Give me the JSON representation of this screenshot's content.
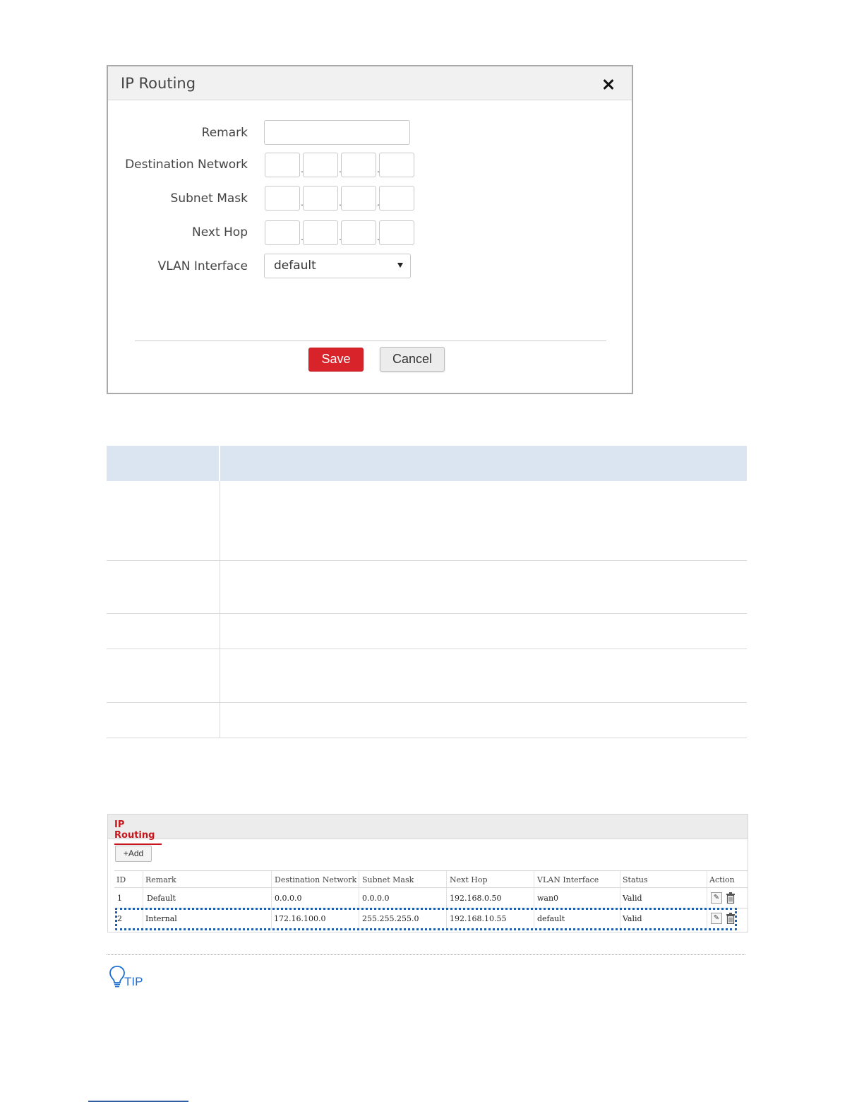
{
  "dialog": {
    "title": "IP Routing",
    "close_icon": "close-icon",
    "fields": {
      "remark_label": "Remark",
      "remark_value": "",
      "destination_label": "Destination Network",
      "subnet_label": "Subnet Mask",
      "nexthop_label": "Next Hop",
      "vlan_label": "VLAN Interface",
      "vlan_value": "default",
      "ip_separator": "."
    },
    "save_label": "Save",
    "cancel_label": "Cancel",
    "colors": {
      "save_bg": "#d9232b",
      "header_bg": "#f1f1f1"
    }
  },
  "param_table": {
    "header_color": "#dbe5f1",
    "rows": 5
  },
  "route_list": {
    "tab_label": "IP Routing",
    "add_label": "+Add",
    "columns": [
      "ID",
      "Remark",
      "Destination Network",
      "Subnet Mask",
      "Next Hop",
      "VLAN Interface",
      "Status",
      "Action"
    ],
    "rows": [
      {
        "id": "1",
        "remark": "Default",
        "destination": "0.0.0.0",
        "mask": "0.0.0.0",
        "next_hop": "192.168.0.50",
        "vlan": "wan0",
        "status": "Valid"
      },
      {
        "id": "2",
        "remark": "Internal",
        "destination": "172.16.100.0",
        "mask": "255.255.255.0",
        "next_hop": "192.168.10.55",
        "vlan": "default",
        "status": "Valid"
      }
    ],
    "action_icons": [
      "edit-icon",
      "delete-icon"
    ],
    "highlight_color": "#1f5fa8",
    "accent": "#c8161d"
  },
  "tip": {
    "label": "TIP",
    "icon": "lightbulb-icon",
    "color": "#1f6fd1"
  }
}
